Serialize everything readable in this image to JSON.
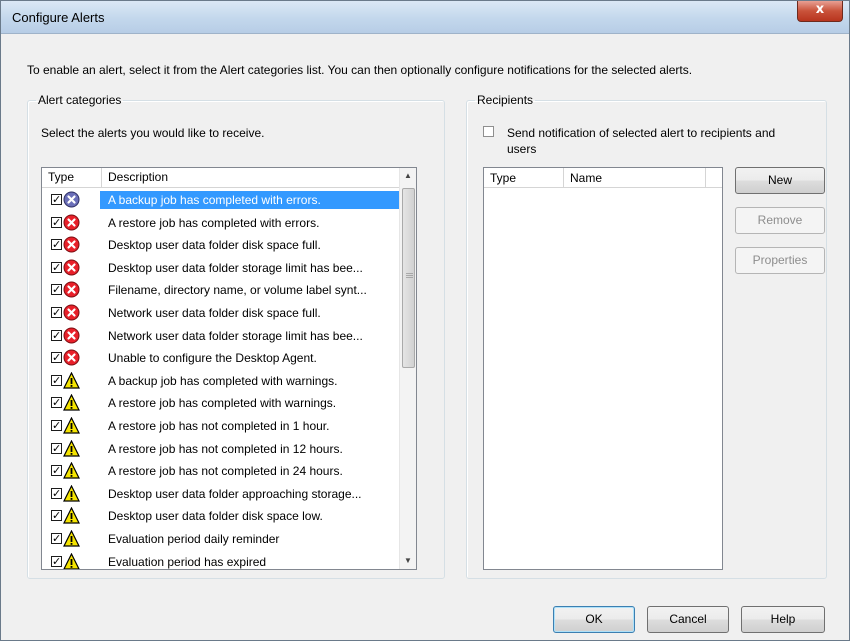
{
  "window": {
    "title": "Configure Alerts",
    "close_label": "x"
  },
  "intro": "To enable an alert, select it from the Alert categories list. You can then optionally configure notifications for the selected alerts.",
  "alert_categories": {
    "legend": "Alert categories",
    "hint": "Select the alerts you would like to receive.",
    "columns": [
      "Type",
      "Description"
    ],
    "rows": [
      {
        "checked": true,
        "icon": "info-error-icon",
        "description": "A backup job has completed with errors.",
        "selected": true
      },
      {
        "checked": true,
        "icon": "error-icon",
        "description": "A restore job has completed with errors."
      },
      {
        "checked": true,
        "icon": "error-icon",
        "description": "Desktop user data folder disk space full."
      },
      {
        "checked": true,
        "icon": "error-icon",
        "description": "Desktop user data folder storage limit has bee..."
      },
      {
        "checked": true,
        "icon": "error-icon",
        "description": "Filename, directory name, or volume label synt..."
      },
      {
        "checked": true,
        "icon": "error-icon",
        "description": "Network user data folder disk space full."
      },
      {
        "checked": true,
        "icon": "error-icon",
        "description": "Network user data folder storage limit has bee..."
      },
      {
        "checked": true,
        "icon": "error-icon",
        "description": "Unable to configure the Desktop Agent."
      },
      {
        "checked": true,
        "icon": "warning-icon",
        "description": "A backup job has completed with warnings."
      },
      {
        "checked": true,
        "icon": "warning-icon",
        "description": "A restore job has completed with warnings."
      },
      {
        "checked": true,
        "icon": "warning-icon",
        "description": "A restore job has not completed in 1 hour."
      },
      {
        "checked": true,
        "icon": "warning-icon",
        "description": "A restore job has not completed in 12 hours."
      },
      {
        "checked": true,
        "icon": "warning-icon",
        "description": "A restore job has not completed in 24 hours."
      },
      {
        "checked": true,
        "icon": "warning-icon",
        "description": "Desktop user data folder approaching storage..."
      },
      {
        "checked": true,
        "icon": "warning-icon",
        "description": "Desktop user data folder disk space low."
      },
      {
        "checked": true,
        "icon": "warning-icon",
        "description": "Evaluation period daily reminder"
      },
      {
        "checked": true,
        "icon": "warning-icon",
        "description": "Evaluation period has expired"
      }
    ]
  },
  "recipients": {
    "legend": "Recipients",
    "notify_label": "Send notification of selected alert to recipients and users",
    "notify_checked": false,
    "columns": [
      "Type",
      "Name"
    ],
    "buttons": {
      "new": "New",
      "remove": "Remove",
      "properties": "Properties"
    }
  },
  "footer": {
    "ok": "OK",
    "cancel": "Cancel",
    "help": "Help"
  },
  "colors": {
    "selection": "#3399ff",
    "error": "#e8202a",
    "warning": "#f5e400"
  }
}
